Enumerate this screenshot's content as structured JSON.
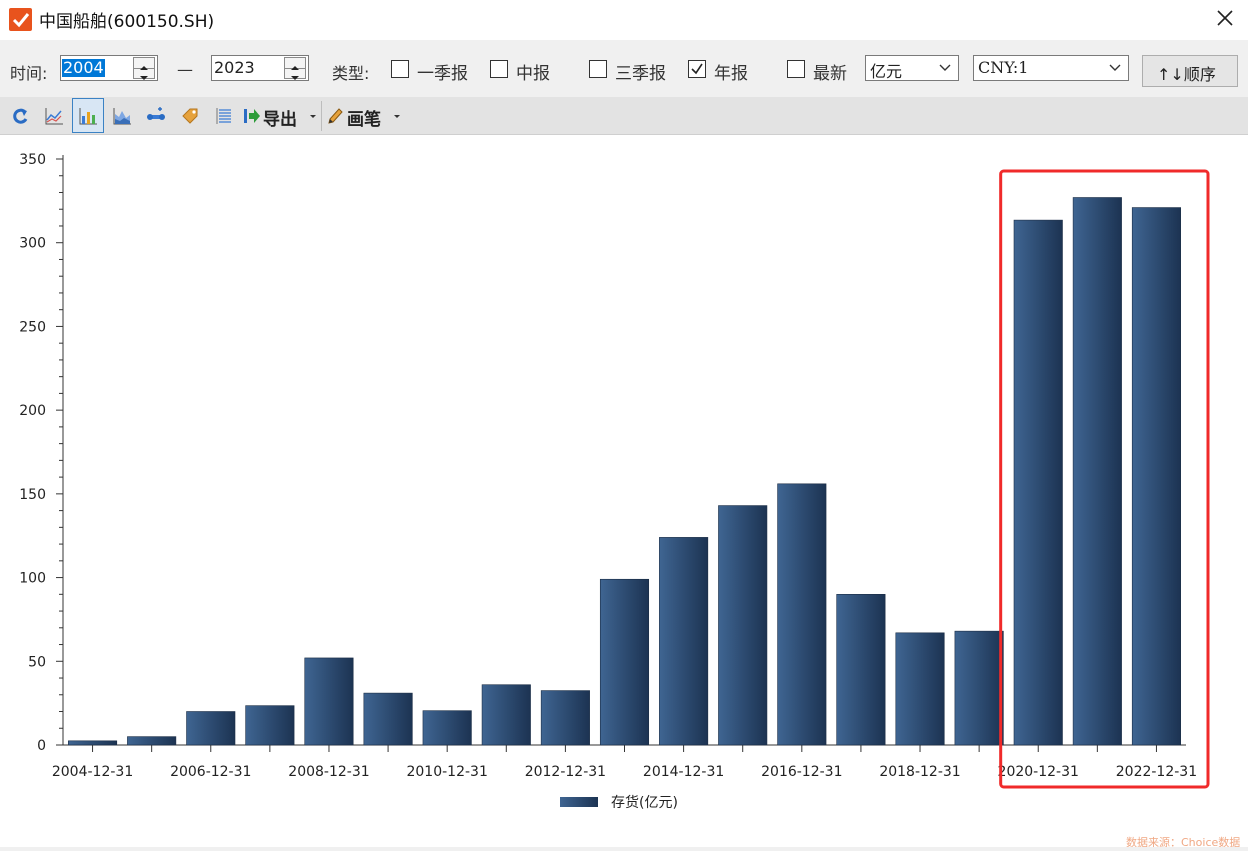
{
  "window": {
    "title": "中国船舶(600150.SH)",
    "icon": "checkmark-app-icon",
    "close_icon": "close-icon"
  },
  "filters": {
    "time_label": "时间:",
    "start_year": "2004",
    "dash": "—",
    "end_year": "2023",
    "type_label": "类型:",
    "options": [
      {
        "label": "一季报",
        "checked": false
      },
      {
        "label": "中报",
        "checked": false
      },
      {
        "label": "三季报",
        "checked": false
      },
      {
        "label": "年报",
        "checked": true
      },
      {
        "label": "最新",
        "checked": false
      }
    ],
    "unit_select": "亿元",
    "currency_select": "CNY:1",
    "order_button": "↑↓顺序"
  },
  "toolbar": {
    "icons": [
      "refresh-icon",
      "line-chart-icon",
      "bar-chart-icon",
      "area-chart-icon",
      "compare-icon",
      "tag-icon",
      "list-icon"
    ],
    "export_label": "导出",
    "pen_label": "画笔"
  },
  "colors": {
    "bar_dark": "#1c3352",
    "bar_light": "#3f6592",
    "highlight": "#f02a2a",
    "accent": "#e8531d"
  },
  "chart_data": {
    "type": "bar",
    "categories": [
      "2004-12-31",
      "2005-12-31",
      "2006-12-31",
      "2007-12-31",
      "2008-12-31",
      "2009-12-31",
      "2010-12-31",
      "2011-12-31",
      "2012-12-31",
      "2013-12-31",
      "2014-12-31",
      "2015-12-31",
      "2016-12-31",
      "2017-12-31",
      "2018-12-31",
      "2019-12-31",
      "2020-12-31",
      "2021-12-31",
      "2022-12-31"
    ],
    "tick_labels": [
      "2004-12-31",
      "2006-12-31",
      "2008-12-31",
      "2010-12-31",
      "2012-12-31",
      "2014-12-31",
      "2016-12-31",
      "2018-12-31",
      "2020-12-31",
      "2022-12-31"
    ],
    "series": [
      {
        "name": "存货(亿元)",
        "values": [
          2.5,
          5,
          20,
          23.5,
          52,
          31,
          20.5,
          36,
          32.5,
          99,
          124,
          143,
          156,
          90,
          67,
          68,
          313.5,
          327,
          321
        ]
      }
    ],
    "ylim": [
      0,
      350
    ],
    "yticks": [
      0,
      50,
      100,
      150,
      200,
      250,
      300,
      350
    ],
    "legend_position": "bottom",
    "highlight_box_categories": [
      "2020-12-31",
      "2022-12-31"
    ]
  },
  "footer": {
    "source": "数据来源：Choice数据"
  }
}
